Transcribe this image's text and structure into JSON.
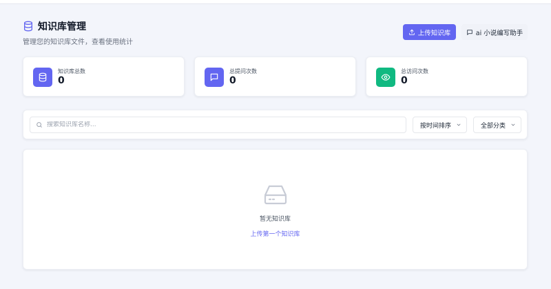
{
  "header": {
    "title": "知识库管理",
    "subtitle": "管理您的知识库文件，查看使用统计",
    "upload_button": "上传知识库",
    "ai_button": "ai 小说编写助手"
  },
  "stats": [
    {
      "label": "知识库总数",
      "value": "0",
      "icon": "database-icon",
      "color": "#6366f1"
    },
    {
      "label": "总提问次数",
      "value": "0",
      "icon": "message-icon",
      "color": "#6366f1"
    },
    {
      "label": "总访问次数",
      "value": "0",
      "icon": "eye-icon",
      "color": "#10b981"
    }
  ],
  "filters": {
    "search_placeholder": "搜索知识库名称...",
    "sort_selected": "按时间排序",
    "category_selected": "全部分类"
  },
  "empty_state": {
    "message": "暂无知识库",
    "action": "上传第一个知识库"
  },
  "colors": {
    "accent": "#6366f1",
    "success": "#10b981",
    "background": "#f3f5fb"
  }
}
